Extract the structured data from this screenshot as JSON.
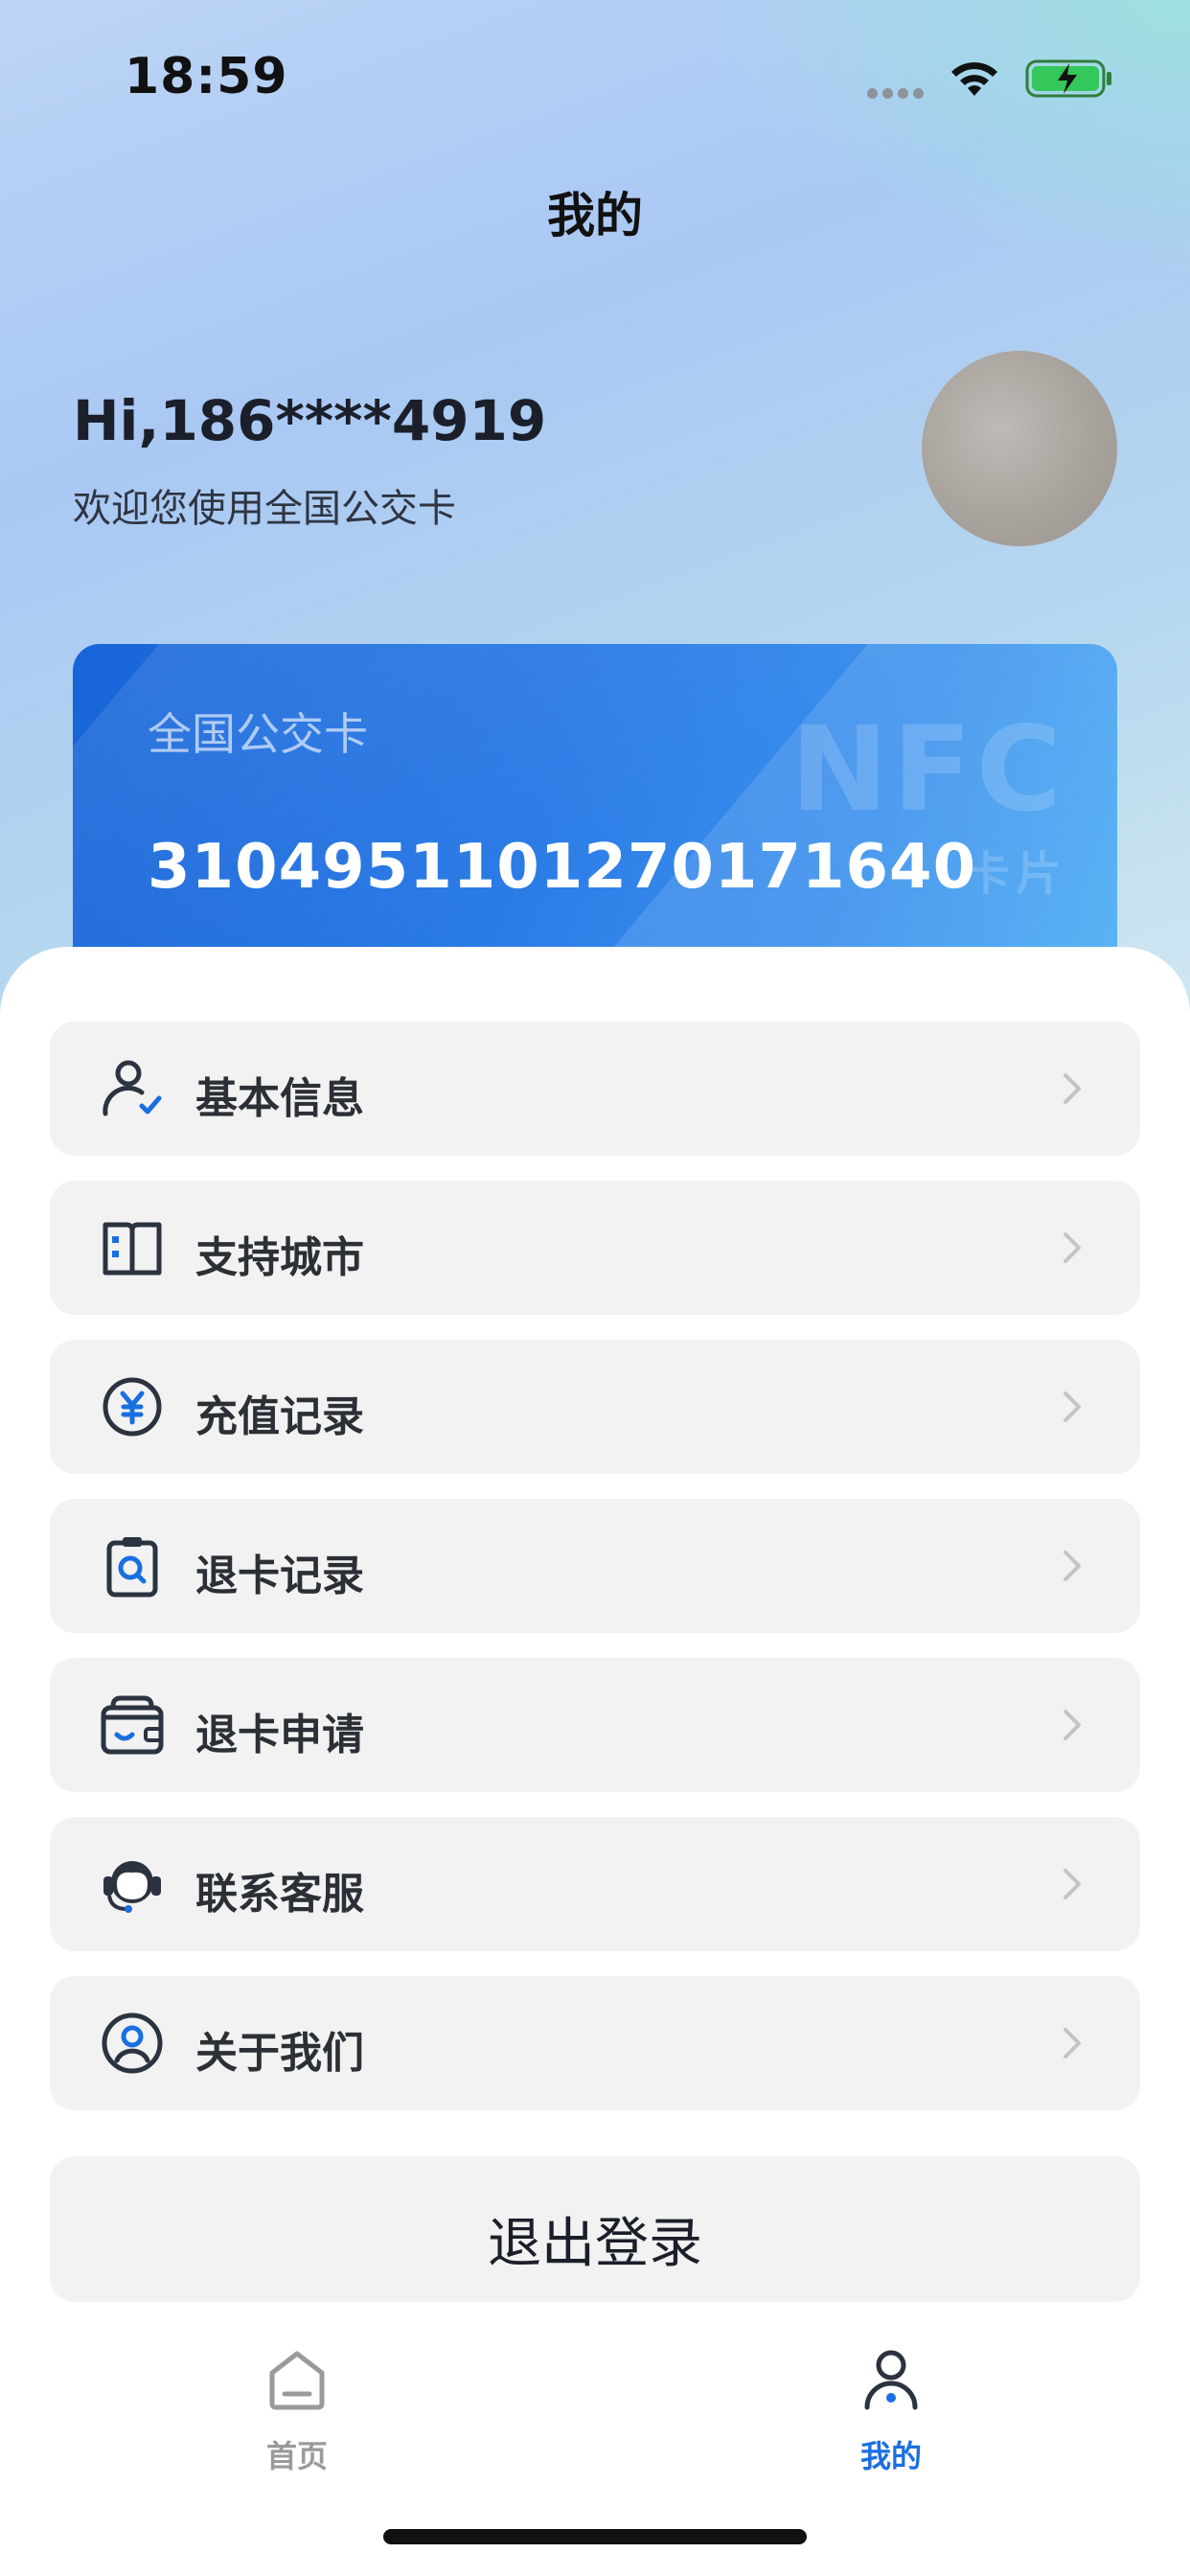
{
  "status_bar": {
    "time": "18:59",
    "icons": [
      "signal-dots-icon",
      "wifi-icon",
      "battery-charging-icon"
    ]
  },
  "header": {
    "title": "我的"
  },
  "profile": {
    "greeting": "Hi,186****4919",
    "subtitle": "欢迎您使用全国公交卡"
  },
  "card": {
    "label": "全国公交卡",
    "number": "3104951101270171640",
    "badge_main": "NFC",
    "badge_sub": "卡片"
  },
  "menu": {
    "items": [
      {
        "label": "基本信息",
        "icon": "user-check-icon"
      },
      {
        "label": "支持城市",
        "icon": "city-book-icon"
      },
      {
        "label": "充值记录",
        "icon": "yuan-circle-icon"
      },
      {
        "label": "退卡记录",
        "icon": "clipboard-search-icon"
      },
      {
        "label": "退卡申请",
        "icon": "wallet-smile-icon"
      },
      {
        "label": "联系客服",
        "icon": "headset-agent-icon"
      },
      {
        "label": "关于我们",
        "icon": "user-circle-icon"
      }
    ]
  },
  "logout": {
    "label": "退出登录"
  },
  "tabbar": {
    "tabs": [
      {
        "label": "首页",
        "icon": "home-icon",
        "active": false
      },
      {
        "label": "我的",
        "icon": "person-icon",
        "active": true
      }
    ]
  },
  "colors": {
    "accent": "#1a6fe0",
    "icon_dark": "#2b3340",
    "menu_bg": "#f2f2f2",
    "tab_inactive": "#9a9a9a"
  }
}
